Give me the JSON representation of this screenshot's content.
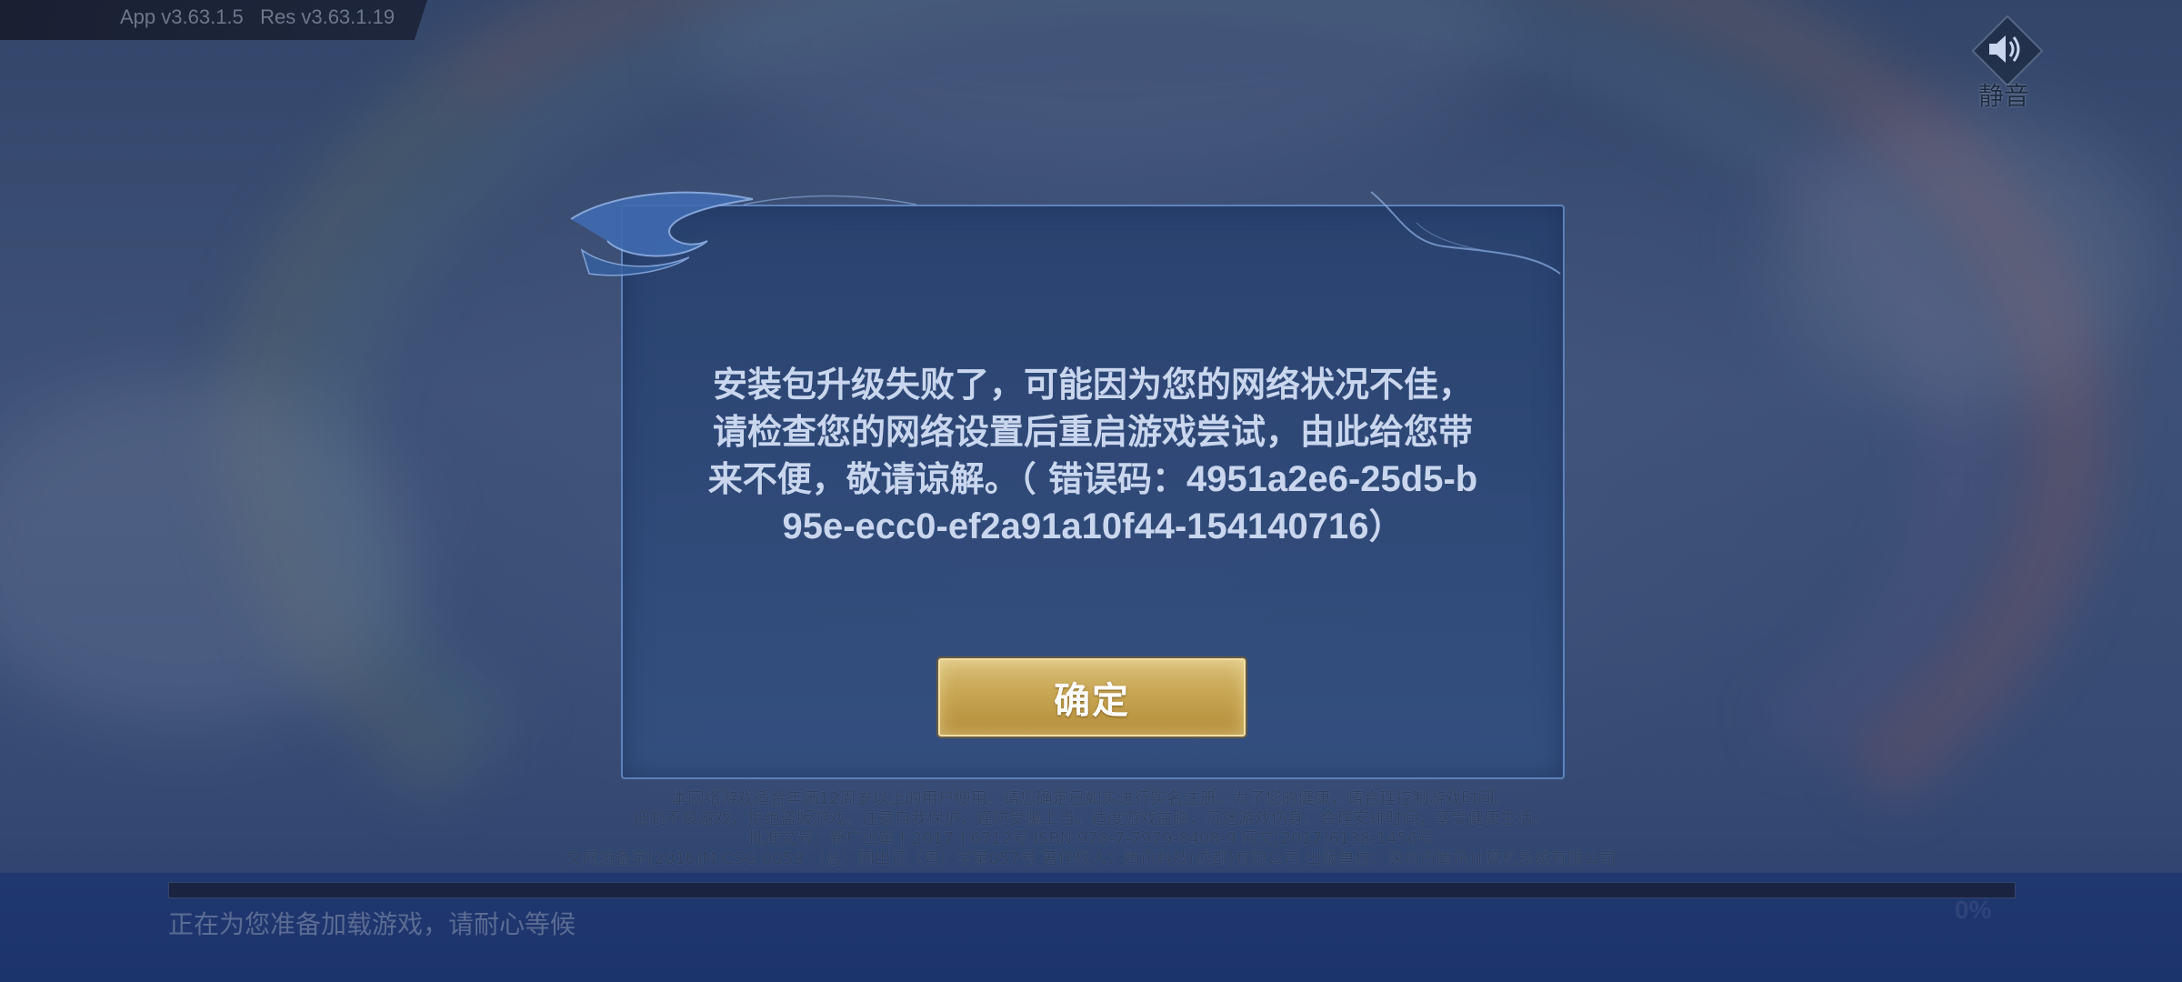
{
  "version": {
    "text": "App v3.63.1.5   Res v3.63.1.19"
  },
  "mute": {
    "label": "静音",
    "icon": "speaker-icon"
  },
  "dialog": {
    "message_line1": "安装包升级失败了，可能因为您的网络状况不佳，",
    "message_line2": "请检查您的网络设置后重启游戏尝试，由此给您带",
    "message_line3_prefix": "来不便，敬请谅解。（ 错误码：",
    "error_code_part1": "4951a2e6-25d5-b",
    "error_code_part2": "95e-ecc0-ef2a91a10f44-154140716",
    "message_suffix": "）",
    "confirm_label": "确定"
  },
  "legal": {
    "line1": "本网络游戏适合年满12周岁以上的用户使用。请您确定已如实进行实名注册。为了您的健康，请合理控制游戏时间。",
    "line2": "抵制不良游戏，拒绝盗版游戏。注意自我保护，谨防受骗上当。适度游戏益脑，沉迷游戏伤身。合理安排时间，享受健康生活。",
    "line3": "批准文号：新广出审 [ 2017 ] 6712号  ISBN 978-7-7979-8408-9  网文[2017]6138-1456号",
    "line4": "文网游备字[2016]M-CSG 0059  （总）网出证（粤）字第057号  著作权人：腾讯科技(成都)有限公司  出版单位：深圳市腾讯计算机系统有限公司"
  },
  "loading": {
    "status_text": "正在为您准备加载游戏，请耐心等候",
    "progress_label": "0%",
    "progress_value": 0
  },
  "colors": {
    "accent_gold": "#c7a552",
    "dialog_border": "#6e96d2",
    "text_light": "#c9d6ee"
  }
}
